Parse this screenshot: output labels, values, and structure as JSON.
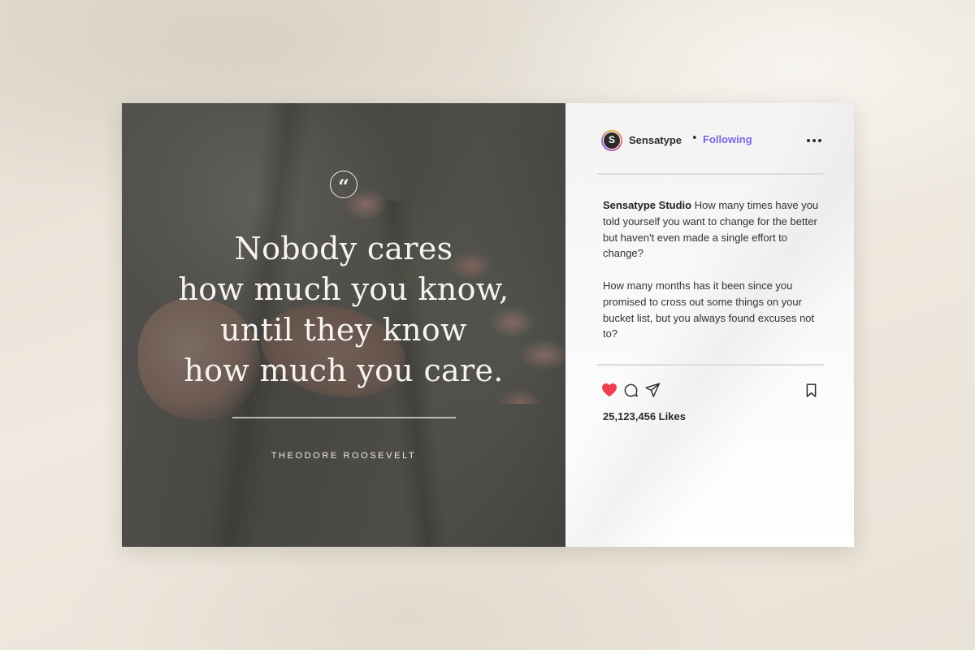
{
  "quote_card": {
    "badge_glyph": "“",
    "quote_lines": [
      "Nobody cares",
      "how much you know,",
      "until they know",
      "how much you care."
    ],
    "author": "THEODORE ROOSEVELT"
  },
  "post": {
    "avatar_letter": "S",
    "username": "Sensatype",
    "separator": "•",
    "follow_status": "Following",
    "caption_author": "Sensatype Studio",
    "caption_paragraph_1": "How many times have you told yourself you want to change for the better but haven't even made a single effort to change?",
    "caption_paragraph_2": "How many months has it been since you promised to cross out some things on your bucket list, but you always found excuses not to?",
    "likes": "25,123,456 Likes",
    "icons": [
      "heart-icon",
      "comment-icon",
      "share-icon",
      "bookmark-icon",
      "more-icon"
    ]
  },
  "colors": {
    "accent": "#7a64e0",
    "heart": "#ee3e4f",
    "background": "#ebe5db"
  }
}
